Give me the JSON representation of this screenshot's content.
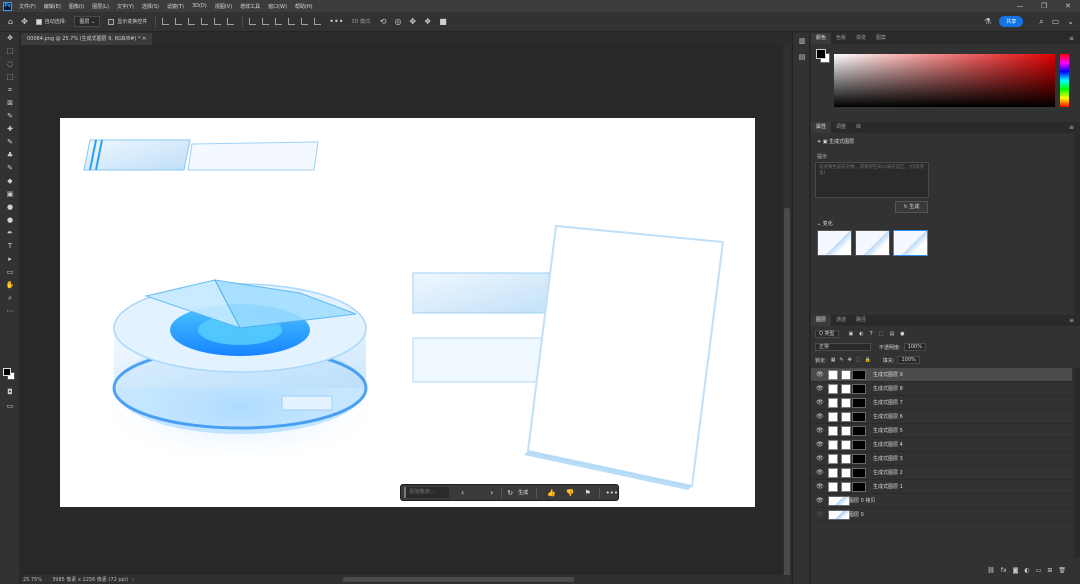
{
  "app": {
    "logo": "Ps",
    "menu": [
      "文件(F)",
      "编辑(E)",
      "图像(I)",
      "图层(L)",
      "文字(Y)",
      "选择(S)",
      "滤镜(T)",
      "3D(D)",
      "视图(V)",
      "增效工具",
      "窗口(W)",
      "帮助(H)"
    ],
    "window_controls": [
      "—",
      "❐",
      "✕"
    ]
  },
  "options": {
    "auto_select_label": "自动选择:",
    "layer_select": "图层 ⌄",
    "show_transform_label": "显示变换控件",
    "three_d_label": "3D 模式:",
    "share_label": "共享"
  },
  "document": {
    "tab_title": "00084.png @ 25.7% (生成式图层 9, RGB/8#) *",
    "zoom": "25.75%",
    "size_info": "3985 像素 x 2256 像素 (72 ppi)"
  },
  "gen_toolbar": {
    "placeholder": "添加描述(...",
    "prev": "‹",
    "next": "›",
    "generate_label": "生成"
  },
  "panels": {
    "color_tabs": [
      "颜色",
      "色板",
      "渐变",
      "图案"
    ],
    "properties_tabs": [
      "属性",
      "调整",
      "库"
    ],
    "properties_layer_type": "生成式图层",
    "prompt_label": "提示",
    "prompt_placeholder": "描述要生成的对象，或保留空白以填充选区。(仅限英语)",
    "generate_button": "生成",
    "variations_title": "变化",
    "layers_tabs": [
      "图层",
      "通道",
      "路径"
    ],
    "kind_filter": "Q 类型",
    "blend_mode": "正常",
    "opacity_label": "不透明度:",
    "opacity_value": "100%",
    "lock_label": "锁定:",
    "fill_label": "填充:",
    "fill_value": "100%",
    "layers": [
      {
        "name": "生成式图层 9",
        "selected": true
      },
      {
        "name": "生成式图层 8",
        "selected": false
      },
      {
        "name": "生成式图层 7",
        "selected": false
      },
      {
        "name": "生成式图层 6",
        "selected": false
      },
      {
        "name": "生成式图层 5",
        "selected": false
      },
      {
        "name": "生成式图层 4",
        "selected": false
      },
      {
        "name": "生成式图层 3",
        "selected": false
      },
      {
        "name": "生成式图层 2",
        "selected": false
      },
      {
        "name": "生成式图层 1",
        "selected": false
      },
      {
        "name": "图层 0 拷贝",
        "selected": false
      },
      {
        "name": "图层 0",
        "selected": false
      }
    ]
  },
  "colors": {
    "accent": "#1473e6",
    "panel_bg": "#323232",
    "workspace_bg": "#282828"
  }
}
